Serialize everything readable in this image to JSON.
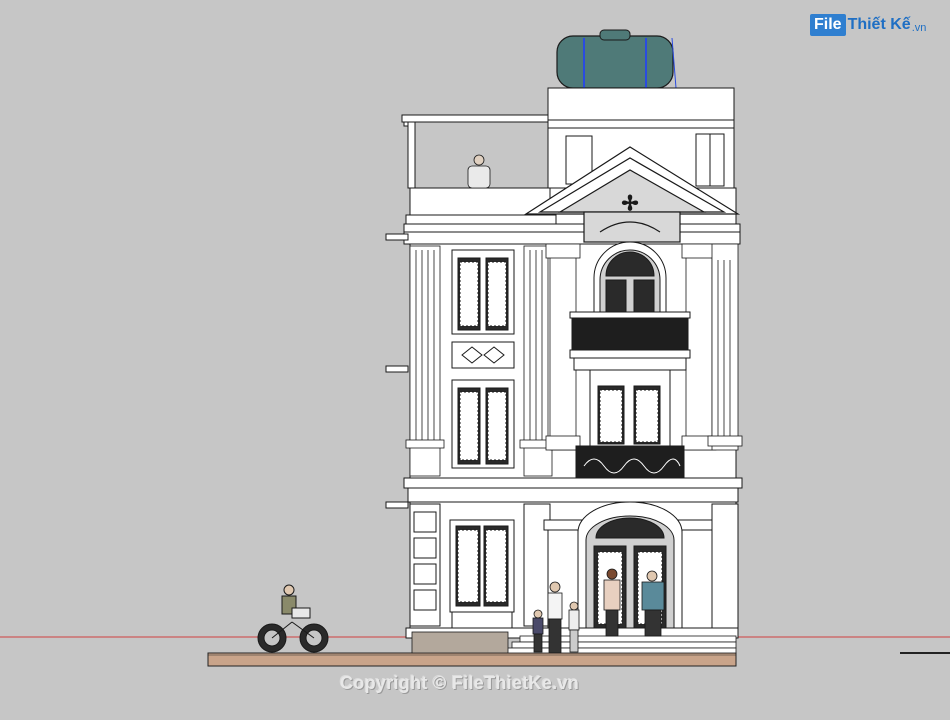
{
  "watermark_logo": {
    "part1": "File",
    "part2": "Thiết Kế",
    "part3": ".vn",
    "color": "#2f7fd0"
  },
  "copyright_text": "Copyright © FileThietKe.vn",
  "colors": {
    "background": "#c6c6c6",
    "facade": "#ffffff",
    "line": "#1a1a1a",
    "water_tank": "#4f7a78",
    "ground": "#c9a48a",
    "ground_line": "#d04040",
    "gable_shade": "#d8d8d8"
  }
}
